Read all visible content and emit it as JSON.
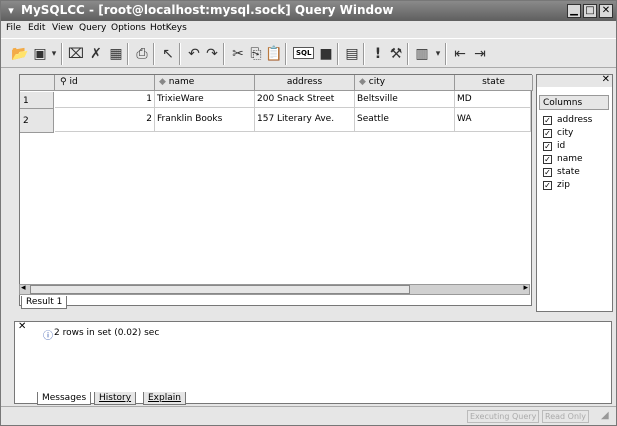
{
  "window": {
    "title": "MySQLCC - [root@localhost:mysql.sock] Query Window",
    "sysmenu_icon": "chevron-down-icon",
    "min_label": "▁",
    "max_label": "□",
    "close_label": "✕"
  },
  "menubar": [
    "File",
    "Edit",
    "View",
    "Query",
    "Options",
    "HotKeys"
  ],
  "toolbar": {
    "icons": [
      "open-icon",
      "save-icon",
      "cut-table-icon",
      "delete-icon",
      "grid-icon",
      "print-icon",
      "cursor-icon",
      "undo-icon",
      "redo-icon",
      "cut-icon",
      "copy-icon",
      "paste-icon",
      "sql-icon",
      "stop-icon",
      "table-icon",
      "execute-icon",
      "explain-icon",
      "layout-icon",
      "prev-icon",
      "next-icon"
    ],
    "sql_label": "SQL"
  },
  "grid": {
    "columns": [
      {
        "label": "id",
        "icon": "key-icon"
      },
      {
        "label": "name",
        "icon": "diamond-icon"
      },
      {
        "label": "address",
        "icon": ""
      },
      {
        "label": "city",
        "icon": "diamond-icon"
      },
      {
        "label": "state",
        "icon": ""
      }
    ],
    "rows": [
      {
        "num": "1",
        "id": "1",
        "name": "TrixieWare",
        "address": "200 Snack Street",
        "city": "Beltsville",
        "state": "MD"
      },
      {
        "num": "2",
        "id": "2",
        "name": "Franklin Books",
        "address": "157 Literary Ave.",
        "city": "Seattle",
        "state": "WA"
      }
    ],
    "tab": "Result 1"
  },
  "columns_panel": {
    "header": "Columns",
    "items": [
      "address",
      "city",
      "id",
      "name",
      "state",
      "zip"
    ]
  },
  "messages": {
    "text": "2 rows in set (0.02) sec",
    "tabs": [
      "Messages",
      "History",
      "Explain"
    ]
  },
  "statusbar": {
    "executing": "Executing Query",
    "readonly": "Read Only"
  }
}
